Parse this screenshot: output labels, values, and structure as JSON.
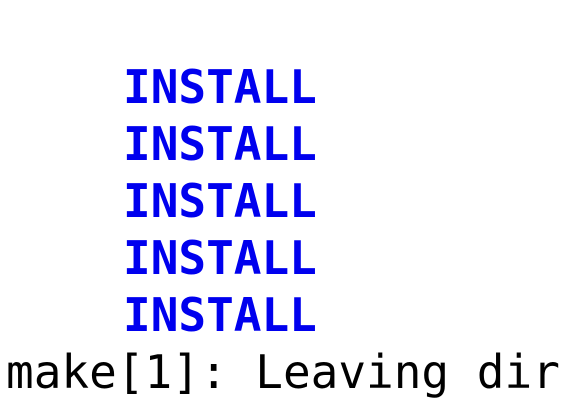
{
  "terminal": {
    "lines": [
      {
        "text": "INSTALL",
        "color": "#0000ee",
        "bold": true
      },
      {
        "text": "INSTALL",
        "color": "#0000ee",
        "bold": true
      },
      {
        "text": "INSTALL",
        "color": "#0000ee",
        "bold": true
      },
      {
        "text": "INSTALL",
        "color": "#0000ee",
        "bold": true
      },
      {
        "text": "INSTALL",
        "color": "#0000ee",
        "bold": true
      }
    ],
    "make_line": "make[1]: Leaving dir"
  }
}
